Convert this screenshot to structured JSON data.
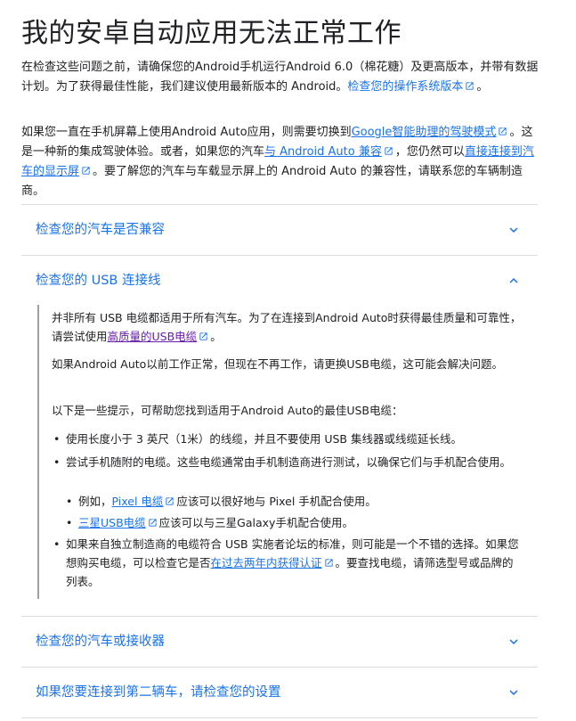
{
  "page": {
    "title": "我的安卓自动应用无法正常工作",
    "intro1": {
      "text": "在检查这些问题之前，请确保您的Android手机运行Android 6.0（棉花糖）及更高版本，并带有数据计划。为了获得最佳性能，我们建议使用最新版本的 Android。",
      "link": "检查您的操作系统版本",
      "tail": "。"
    },
    "intro2": {
      "t1": "如果您一直在手机屏幕上使用Android Auto应用，则需要切换到",
      "link1a": "Google智能助理",
      "link1b": "的驾驶模式",
      "t2": "。这是一种新的集成驾驶体验。或者，如果您的汽车",
      "link2": "与 Android Auto 兼容",
      "t3": "，您仍然可以",
      "link3": "直接连接到汽车的显示屏",
      "t4": "。要了解您的汽车与车载显示屏上的 Android Auto 的兼容性，请联系您的车辆制造商。"
    }
  },
  "accordion": [
    {
      "title": "检查您的汽车是否兼容",
      "expanded": false
    },
    {
      "title": "检查您的 USB 连接线",
      "expanded": true
    },
    {
      "title": "检查您的汽车或接收器",
      "expanded": false
    },
    {
      "title": "如果您要连接到第二辆车，请检查您的设置",
      "expanded": false
    }
  ],
  "usb_panel": {
    "p1_text": "并非所有 USB 电缆都适用于所有汽车。为了在连接到Android Auto时获得最佳质量和可靠性，请尝试使用",
    "p1_link": "高质量的USB电缆",
    "p1_tail": "。",
    "p2": "如果Android Auto以前工作正常，但现在不再工作，请更换USB电缆，这可能会解决问题。",
    "p3": "以下是一些提示，可帮助您找到适用于Android Auto的最佳USB电缆：",
    "bullets": {
      "b1": "使用长度小于 3 英尺（1米）的线缆，并且不要使用 USB 集线器或线缆延长线。",
      "b2": "尝试手机随附的电缆。这些电缆通常由手机制造商进行测试，以确保它们与手机配合使用。",
      "b2a_pre": "例如，",
      "b2a_link": "Pixel 电缆",
      "b2a_post": "应该可以很好地与 Pixel 手机配合使用。",
      "b2b_link": "三星USB电缆",
      "b2b_post": "应该可以与三星Galaxy手机配合使用。",
      "b3_pre": "如果来自独立制造商的电缆符合 USB 实施者论坛的标准，则可能是一个不错的选择。如果您想购买电缆，可以检查它是否",
      "b3_link": "在过去两年内获得认证",
      "b3_post": "。要查找电缆，请筛选型号或品牌的列表。"
    },
    "bullet_glyph": "•"
  },
  "colors": {
    "link": "#1a73e8",
    "visited_link": "#681da8",
    "text": "#202124",
    "divider": "#dadce0",
    "panel_border": "#9aa0a6"
  },
  "icons": {
    "external_link": "external-link-icon",
    "chevron_down": "chevron-down-icon",
    "chevron_up": "chevron-up-icon"
  }
}
